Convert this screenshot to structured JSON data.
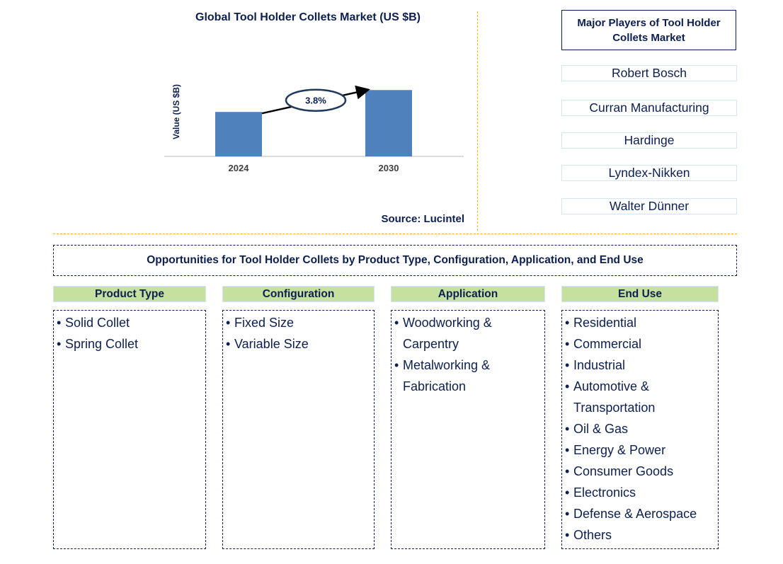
{
  "chart_data": {
    "type": "bar",
    "title": "Global Tool Holder Collets Market (US $B)",
    "xlabel": "",
    "ylabel": "Value (US $B)",
    "categories": [
      "2024",
      "2030"
    ],
    "values": [
      0.67,
      1.0
    ],
    "values_note": "relative bar heights; no numeric values printed",
    "ylim": [
      0,
      1.6
    ],
    "grid": false,
    "annotation": {
      "label": "3.8%",
      "type": "CAGR arrow",
      "from": "2024",
      "to": "2030"
    },
    "bar_color": "#4f81bd"
  },
  "source": "Source: Lucintel",
  "players": {
    "title": "Major Players of Tool Holder Collets Market",
    "items": [
      "Robert Bosch",
      "Curran Manufacturing",
      "Hardinge",
      "Lyndex-Nikken",
      "Walter Dünner"
    ]
  },
  "opportunities": {
    "title": "Opportunities for Tool Holder Collets by Product Type, Configuration, Application, and End Use",
    "categories": [
      {
        "label": "Product Type",
        "items": [
          "Solid Collet",
          "Spring Collet"
        ]
      },
      {
        "label": "Configuration",
        "items": [
          "Fixed Size",
          "Variable Size"
        ]
      },
      {
        "label": "Application",
        "items": [
          "Woodworking & Carpentry",
          "Metalworking & Fabrication"
        ]
      },
      {
        "label": "End Use",
        "items": [
          "Residential",
          "Commercial",
          "Industrial",
          "Automotive & Transportation",
          "Oil & Gas",
          "Energy & Power",
          "Consumer Goods",
          "Electronics",
          "Defense & Aerospace",
          "Others"
        ]
      }
    ]
  },
  "colors": {
    "text": "#0d1f4f",
    "bar": "#4f81bd",
    "header_fill": "#c6e0a0",
    "separator": "#f5b800"
  }
}
